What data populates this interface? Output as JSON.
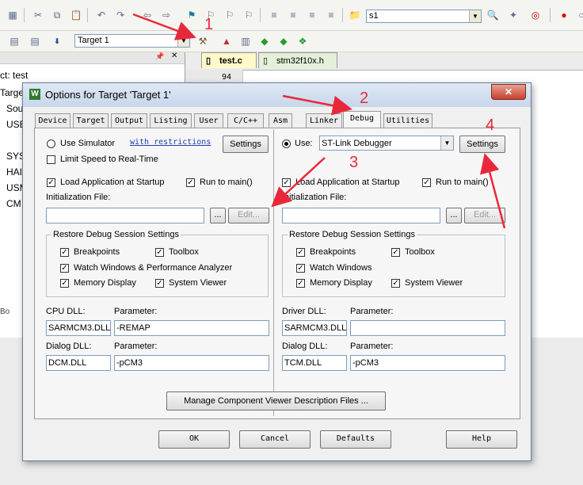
{
  "toolbar": {
    "target_combo": "Target 1",
    "find_combo": "s1"
  },
  "project_tree": {
    "items": [
      "ct: test",
      "Target",
      "Sou",
      "USE",
      "SYS",
      "HAI",
      "USM",
      "CM"
    ],
    "bottom_tab": "Bo"
  },
  "editor": {
    "tabs": [
      "test.c",
      "stm32f10x.h"
    ],
    "line_number": "94"
  },
  "dialog": {
    "title": "Options for Target 'Target 1'",
    "close_label": "✕",
    "tabs": [
      "Device",
      "Target",
      "Output",
      "Listing",
      "User",
      "C/C++",
      "Asm",
      "Linker",
      "Debug",
      "Utilities"
    ],
    "active_tab": "Debug",
    "left": {
      "use_simulator": "Use Simulator",
      "with_restrictions": "with restrictions",
      "settings": "Settings",
      "limit_speed": "Limit Speed to Real-Time",
      "load_app": "Load Application at Startup",
      "run_to_main": "Run to main()",
      "init_file_label": "Initialization File:",
      "init_file_value": "",
      "browse": "...",
      "edit": "Edit...",
      "restore_group": "Restore Debug Session Settings",
      "breakpoints": "Breakpoints",
      "toolbox": "Toolbox",
      "watch_windows": "Watch Windows & Performance Analyzer",
      "memory_display": "Memory Display",
      "system_viewer": "System Viewer",
      "dll_label": "CPU DLL:",
      "param_label": "Parameter:",
      "dll_value": "SARMCM3.DLL",
      "param_value": "-REMAP",
      "dialog_dll_label": "Dialog DLL:",
      "dialog_param_label": "Parameter:",
      "dialog_dll_value": "DCM.DLL",
      "dialog_param_value": "-pCM3"
    },
    "right": {
      "use": "Use:",
      "debugger": "ST-Link Debugger",
      "settings": "Settings",
      "load_app": "Load Application at Startup",
      "run_to_main": "Run to main()",
      "init_file_label": "Initialization File:",
      "init_file_value": "",
      "browse": "...",
      "edit": "Edit...",
      "restore_group": "Restore Debug Session Settings",
      "breakpoints": "Breakpoints",
      "toolbox": "Toolbox",
      "watch_windows": "Watch Windows",
      "memory_display": "Memory Display",
      "system_viewer": "System Viewer",
      "dll_label": "Driver DLL:",
      "param_label": "Parameter:",
      "dll_value": "SARMCM3.DLL",
      "param_value": "",
      "dialog_dll_label": "Dialog DLL:",
      "dialog_param_label": "Parameter:",
      "dialog_dll_value": "TCM.DLL",
      "dialog_param_value": "-pCM3"
    },
    "manage_button": "Manage Component Viewer Description Files ...",
    "footer": {
      "ok": "OK",
      "cancel": "Cancel",
      "defaults": "Defaults",
      "help": "Help"
    }
  },
  "annotations": {
    "n1": "1",
    "n2": "2",
    "n3": "3",
    "n4": "4",
    "color": "#e8283a"
  }
}
